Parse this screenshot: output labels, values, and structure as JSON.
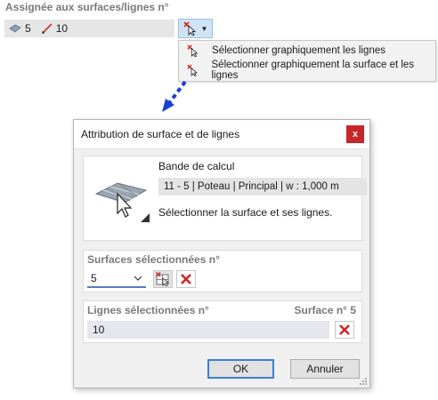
{
  "assign": {
    "title": "Assignée aux surfaces/lignes n°",
    "surface_value": "5",
    "line_value": "10"
  },
  "menu": {
    "items": [
      {
        "label": "Sélectionner graphiquement les lignes"
      },
      {
        "label": "Sélectionner graphiquement la surface et les lignes"
      }
    ]
  },
  "dialog": {
    "title": "Attribution de surface et de lignes",
    "close_label": "x",
    "info": {
      "label": "Bande de calcul",
      "value": "11 - 5 | Poteau | Principal | w : 1,000 m",
      "hint": "Sélectionner la surface et ses lignes."
    },
    "surfaces": {
      "title": "Surfaces sélectionnées n°",
      "selected": "5"
    },
    "lines": {
      "title": "Lignes sélectionnées n°",
      "surface_label": "Surface n° 5",
      "value": "10"
    },
    "ok_label": "OK",
    "cancel_label": "Annuler"
  },
  "colors": {
    "accent": "#3c7fd6",
    "delete": "#d32424",
    "arrow": "#1a3fd6",
    "section_title": "#7a7a7a"
  }
}
